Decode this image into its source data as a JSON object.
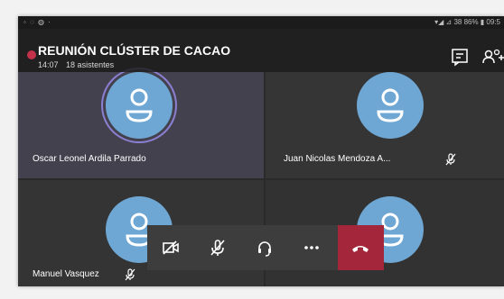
{
  "meeting": {
    "title": "REUNIÓN CLÚSTER DE CACAO",
    "time": "14:07",
    "attendees": "18 asistentes"
  },
  "status_bar": {
    "left": "◦ ◌ ◍ ·",
    "right": "▾◢ ⊿ 38 86% ▮ 09:5"
  },
  "header_icons": [
    "chat-icon",
    "participants-icon"
  ],
  "participants": [
    {
      "name": "Oscar Leonel Ardila Parrado",
      "muted": false,
      "speaking": true
    },
    {
      "name": "Juan Nicolas Mendoza A...",
      "muted": true,
      "speaking": false
    },
    {
      "name": "Manuel Vasquez",
      "muted": true,
      "speaking": false
    },
    {
      "name": "",
      "muted": false,
      "speaking": false
    }
  ],
  "controls": [
    "camera-off-icon",
    "mic-off-icon",
    "headset-icon",
    "more-icon",
    "hang-up-icon"
  ],
  "colors": {
    "avatar": "#6fa7d4",
    "speaking_ring": "#8b7fd1",
    "hang_up": "#a4263b",
    "record_dot": "#c4314b"
  }
}
